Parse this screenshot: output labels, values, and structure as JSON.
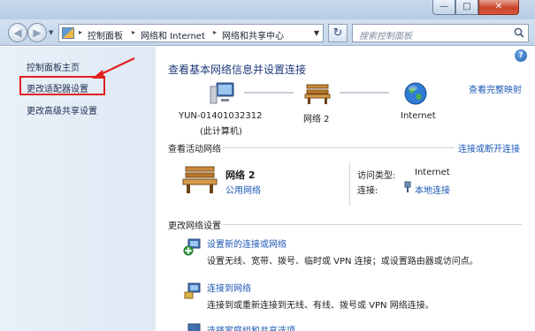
{
  "window": {
    "minimize_glyph": "—",
    "maximize_glyph": "□",
    "close_glyph": "✕"
  },
  "nav": {
    "back_glyph": "◀",
    "forward_glyph": "▶",
    "dropdown_glyph": "▼",
    "breadcrumbs": [
      "控制面板",
      "网络和 Internet",
      "网络和共享中心"
    ],
    "breadcrumb_sep": "▸",
    "refresh_glyph": "↻",
    "search_placeholder": "搜索控制面板"
  },
  "sidebar": {
    "items": [
      {
        "label": "控制面板主页"
      },
      {
        "label": "更改适配器设置"
      },
      {
        "label": "更改高级共享设置"
      }
    ]
  },
  "main": {
    "help_glyph": "?",
    "heading": "查看基本网络信息并设置连接",
    "full_map_link": "查看完整映射",
    "map": {
      "computer_name": "YUN-01401032312",
      "computer_sub": "(此计算机)",
      "network_name": "网络  2",
      "internet_label": "Internet"
    },
    "active_networks": {
      "title": "查看活动网络",
      "connect_link": "连接或断开连接",
      "network_name": "网络  2",
      "network_type": "公用网络",
      "access_type_label": "访问类型:",
      "access_type_value": "Internet",
      "connection_label": "连接:",
      "connection_value": "本地连接"
    },
    "settings": {
      "title": "更改网络设置",
      "tasks": [
        {
          "link": "设置新的连接或网络",
          "desc": "设置无线、宽带、拨号、临时或 VPN 连接；或设置路由器或访问点。"
        },
        {
          "link": "连接到网络",
          "desc": "连接到或重新连接到无线、有线、拨号或 VPN 网络连接。"
        },
        {
          "link": "选择家庭组和共享选项",
          "desc": ""
        }
      ]
    }
  },
  "colors": {
    "link": "#1c58b5",
    "heading": "#1e3a78",
    "highlight_box": "#e02020",
    "sidebar_bg": "#e3ecf6"
  }
}
